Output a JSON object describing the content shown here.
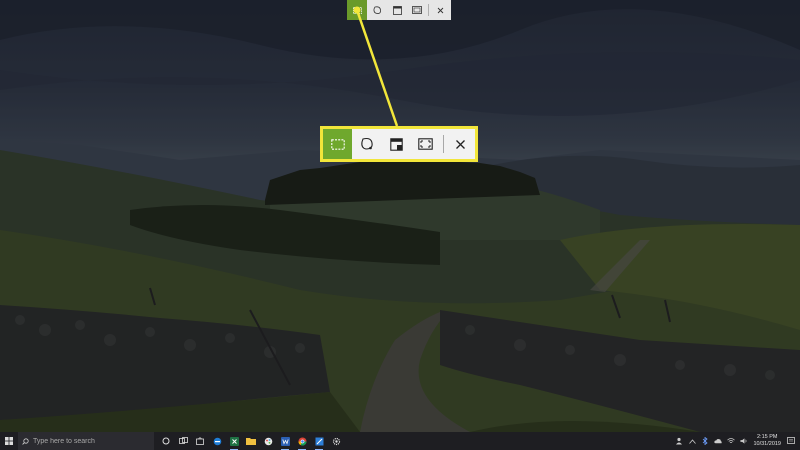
{
  "snip_toolbar": {
    "buttons": [
      {
        "name": "rectangular-snip",
        "icon": "rectangle-snip-icon",
        "active": true
      },
      {
        "name": "freeform-snip",
        "icon": "freeform-snip-icon",
        "active": false
      },
      {
        "name": "window-snip",
        "icon": "window-snip-icon",
        "active": false
      },
      {
        "name": "fullscreen-snip",
        "icon": "fullscreen-snip-icon",
        "active": false
      },
      {
        "name": "close",
        "icon": "close-icon",
        "active": false
      }
    ],
    "active_color": "#6fa82d",
    "highlight_color": "#f2e63a"
  },
  "taskbar": {
    "search_placeholder": "Type here to search",
    "apps": [
      "cortana-icon",
      "task-view-icon",
      "store-icon",
      "edge-icon",
      "excel-icon",
      "explorer-icon",
      "paint-icon",
      "word-icon",
      "chrome-icon",
      "snip-sketch-icon",
      "settings-icon"
    ],
    "clock_time": "2:15 PM",
    "clock_date": "10/31/2019"
  }
}
